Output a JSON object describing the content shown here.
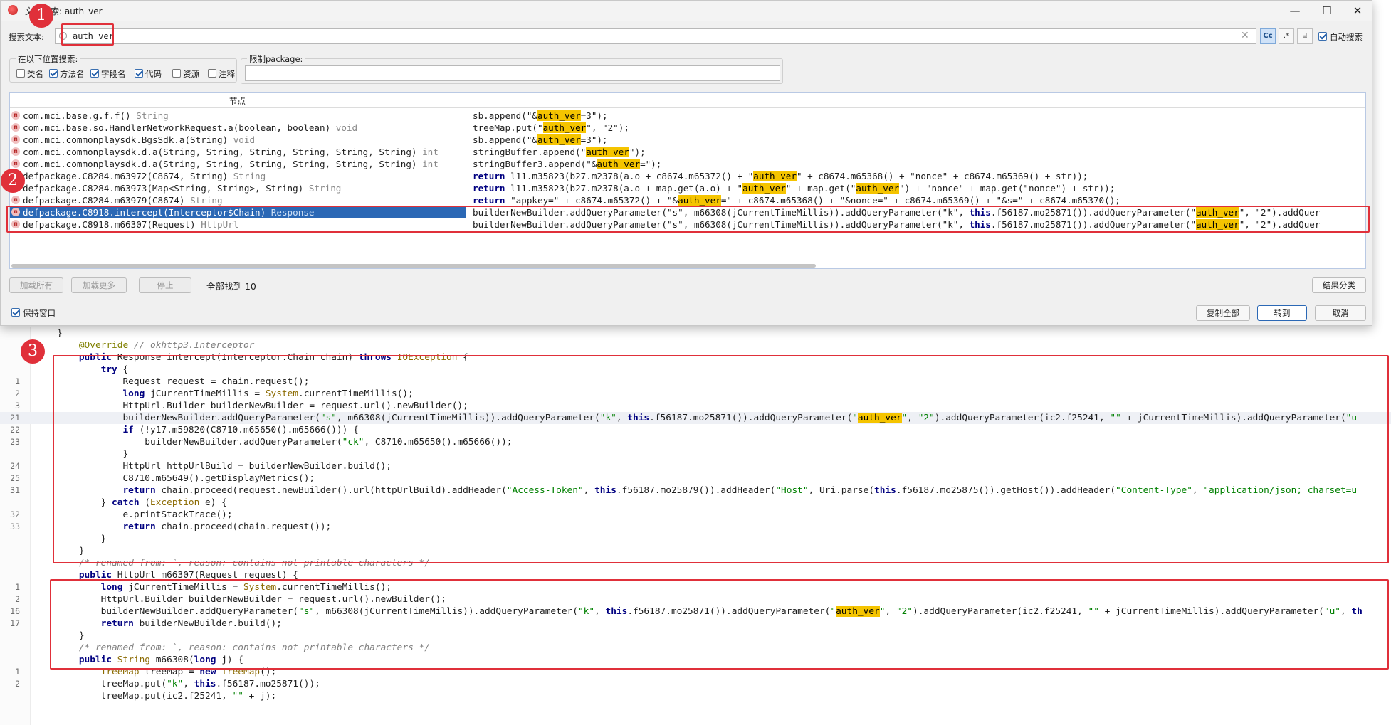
{
  "window": {
    "title": "文本搜索: auth_ver",
    "minimize": "—",
    "maximize": "☐",
    "close": "✕"
  },
  "search": {
    "label": "搜索文本:",
    "value": "auth_ver",
    "auto_search_label": "自动搜索",
    "auto_search_checked": true,
    "toolbar": {
      "case_sensitive": "Cc",
      "regex": ".*",
      "word": "⌸"
    }
  },
  "scope": {
    "title": "在以下位置搜索:",
    "options": [
      {
        "label": "类名",
        "checked": false
      },
      {
        "label": "方法名",
        "checked": true
      },
      {
        "label": "字段名",
        "checked": true
      },
      {
        "label": "代码",
        "checked": true
      },
      {
        "label": "资源",
        "checked": false
      },
      {
        "label": "注释",
        "checked": false
      }
    ]
  },
  "package_filter": {
    "title": "限制package:",
    "value": ""
  },
  "results": {
    "column_node": "节点",
    "rows": [
      {
        "node": "com.mci.base.g.f.f()",
        "type": "String",
        "code": [
          [
            "",
            "sb.append(\"&"
          ],
          [
            "hit",
            "auth_ver"
          ],
          [
            "",
            "=3\");"
          ]
        ]
      },
      {
        "node": "com.mci.base.so.HandlerNetworkRequest.a(boolean, boolean)",
        "type": "void",
        "code": [
          [
            "",
            "treeMap.put(\""
          ],
          [
            "hit",
            "auth_ver"
          ],
          [
            "",
            "\", \"2\");"
          ]
        ]
      },
      {
        "node": "com.mci.commonplaysdk.BgsSdk.a(String)",
        "type": "void",
        "code": [
          [
            "",
            "sb.append(\"&"
          ],
          [
            "hit",
            "auth_ver"
          ],
          [
            "",
            "=3\");"
          ]
        ]
      },
      {
        "node": "com.mci.commonplaysdk.d.a(String, String, String, String, String, String)",
        "type": "int",
        "code": [
          [
            "",
            "stringBuffer.append(\""
          ],
          [
            "hit",
            "auth_ver"
          ],
          [
            "",
            "\");"
          ]
        ]
      },
      {
        "node": "com.mci.commonplaysdk.d.a(String, String, String, String, String, String)",
        "type": "int",
        "code": [
          [
            "",
            "stringBuffer3.append(\"&"
          ],
          [
            "hit",
            "auth_ver"
          ],
          [
            "",
            "=\");"
          ]
        ]
      },
      {
        "node": "defpackage.C8284.m63972(C8674, String)",
        "type": "String",
        "code": [
          [
            "kw",
            "return"
          ],
          [
            "",
            " l11.m35823(b27.m2378(a.o + c8674.m65372() + \""
          ],
          [
            "hit",
            "auth_ver"
          ],
          [
            "",
            "\" + c8674.m65368() + \"nonce\" + c8674.m65369() + str));"
          ]
        ]
      },
      {
        "node": "defpackage.C8284.m63973(Map<String, String>, String)",
        "type": "String",
        "code": [
          [
            "kw",
            "return"
          ],
          [
            "",
            " l11.m35823(b27.m2378(a.o + map.get(a.o) + \""
          ],
          [
            "hit",
            "auth_ver"
          ],
          [
            "",
            "\" + map.get(\""
          ],
          [
            "hit",
            "auth_ver"
          ],
          [
            "",
            "\") + \"nonce\" + map.get(\"nonce\") + str));"
          ]
        ]
      },
      {
        "node": "defpackage.C8284.m63979(C8674)",
        "type": "String",
        "code": [
          [
            "kw",
            "return"
          ],
          [
            "",
            " \"appkey=\" + c8674.m65372() + \"&"
          ],
          [
            "hit",
            "auth_ver"
          ],
          [
            "",
            "=\" + c8674.m65368() + \"&nonce=\" + c8674.m65369() + \"&s=\" + c8674.m65370();"
          ]
        ]
      },
      {
        "node": "defpackage.C8918.intercept(Interceptor$Chain)",
        "type": "Response",
        "selected": true,
        "code": [
          [
            "",
            "builderNewBuilder.addQueryParameter(\"s\", m66308(jCurrentTimeMillis)).addQueryParameter(\"k\", "
          ],
          [
            "kw",
            "this"
          ],
          [
            "",
            ".f56187.mo25871()).addQueryParameter(\""
          ],
          [
            "hit",
            "auth_ver"
          ],
          [
            "",
            "\", \"2\").addQuer"
          ]
        ]
      },
      {
        "node": "defpackage.C8918.m66307(Request)",
        "type": "HttpUrl",
        "code": [
          [
            "",
            "builderNewBuilder.addQueryParameter(\"s\", m66308(jCurrentTimeMillis)).addQueryParameter(\"k\", "
          ],
          [
            "kw",
            "this"
          ],
          [
            "",
            ".f56187.mo25871()).addQueryParameter(\""
          ],
          [
            "hit",
            "auth_ver"
          ],
          [
            "",
            "\", \"2\").addQuer"
          ]
        ]
      }
    ]
  },
  "bottom": {
    "load_all": "加载所有",
    "load_more": "加载更多",
    "stop": "停止",
    "found": "全部找到 10",
    "group_results": "结果分类",
    "keep_window": "保持窗口",
    "keep_window_checked": true,
    "copy_all": "复制全部",
    "goto": "转到",
    "cancel": "取消"
  },
  "badges": [
    "1",
    "2",
    "3"
  ],
  "editor": {
    "lines": [
      {
        "n": "",
        "code": [
          [
            "",
            "}"
          ]
        ]
      },
      {
        "n": "",
        "code": [
          [
            "",
            "    "
          ],
          [
            "ann",
            "@Override"
          ],
          [
            "cm",
            " // okhttp3.Interceptor"
          ]
        ]
      },
      {
        "n": "",
        "code": [
          [
            "",
            "    "
          ],
          [
            "kw",
            "public"
          ],
          [
            "",
            " Response intercept(Interceptor.Chain chain) "
          ],
          [
            "kw",
            "throws"
          ],
          [
            "",
            " "
          ],
          [
            "ty",
            "IOException"
          ],
          [
            "",
            " {"
          ]
        ]
      },
      {
        "n": "",
        "code": [
          [
            "",
            "        "
          ],
          [
            "kw",
            "try"
          ],
          [
            "",
            " {"
          ]
        ]
      },
      {
        "n": "1",
        "code": [
          [
            "",
            "            Request request = chain.request();"
          ]
        ]
      },
      {
        "n": "2",
        "code": [
          [
            "",
            "            "
          ],
          [
            "kw",
            "long"
          ],
          [
            "",
            " jCurrentTimeMillis = "
          ],
          [
            "ty",
            "System"
          ],
          [
            "",
            ".currentTimeMillis();"
          ]
        ]
      },
      {
        "n": "3",
        "code": [
          [
            "",
            "            HttpUrl.Builder builderNewBuilder = request.url().newBuilder();"
          ]
        ]
      },
      {
        "n": "21",
        "hl": true,
        "code": [
          [
            "",
            "            builderNewBuilder.addQueryParameter("
          ],
          [
            "str",
            "\"s\""
          ],
          [
            "",
            ", m66308(jCurrentTimeMillis)).addQueryParameter("
          ],
          [
            "str",
            "\"k\""
          ],
          [
            "",
            ", "
          ],
          [
            "kw",
            "this"
          ],
          [
            "",
            ".f56187.mo25871()).addQueryParameter("
          ],
          [
            "str",
            "\""
          ],
          [
            "hit",
            "auth_ver"
          ],
          [
            "str",
            "\""
          ],
          [
            "",
            ", "
          ],
          [
            "str",
            "\"2\""
          ],
          [
            "",
            ").addQueryParameter(ic2.f25241, "
          ],
          [
            "str",
            "\"\""
          ],
          [
            "",
            " + jCurrentTimeMillis).addQueryParameter("
          ],
          [
            "str",
            "\"u"
          ]
        ]
      },
      {
        "n": "22",
        "code": [
          [
            "",
            "            "
          ],
          [
            "kw",
            "if"
          ],
          [
            "",
            " (!y17.m59820(C8710.m65650().m65666())) {"
          ]
        ]
      },
      {
        "n": "23",
        "code": [
          [
            "",
            "                builderNewBuilder.addQueryParameter("
          ],
          [
            "str",
            "\"ck\""
          ],
          [
            "",
            ", C8710.m65650().m65666());"
          ]
        ]
      },
      {
        "n": "",
        "code": [
          [
            "",
            "            }"
          ]
        ]
      },
      {
        "n": "24",
        "code": [
          [
            "",
            "            HttpUrl httpUrlBuild = builderNewBuilder.build();"
          ]
        ]
      },
      {
        "n": "25",
        "code": [
          [
            "",
            "            C8710.m65649().getDisplayMetrics();"
          ]
        ]
      },
      {
        "n": "31",
        "code": [
          [
            "",
            "            "
          ],
          [
            "kw",
            "return"
          ],
          [
            "",
            " chain.proceed(request.newBuilder().url(httpUrlBuild).addHeader("
          ],
          [
            "str",
            "\"Access-Token\""
          ],
          [
            "",
            ", "
          ],
          [
            "kw",
            "this"
          ],
          [
            "",
            ".f56187.mo25879()).addHeader("
          ],
          [
            "str",
            "\"Host\""
          ],
          [
            "",
            ", Uri.parse("
          ],
          [
            "kw",
            "this"
          ],
          [
            "",
            ".f56187.mo25875()).getHost()).addHeader("
          ],
          [
            "str",
            "\"Content-Type\""
          ],
          [
            "",
            ", "
          ],
          [
            "str",
            "\"application/json; charset=u"
          ]
        ]
      },
      {
        "n": "",
        "code": [
          [
            "",
            "        } "
          ],
          [
            "kw",
            "catch"
          ],
          [
            "",
            " ("
          ],
          [
            "ty",
            "Exception"
          ],
          [
            "",
            " e) {"
          ]
        ]
      },
      {
        "n": "32",
        "code": [
          [
            "",
            "            e.printStackTrace();"
          ]
        ]
      },
      {
        "n": "33",
        "code": [
          [
            "",
            "            "
          ],
          [
            "kw",
            "return"
          ],
          [
            "",
            " chain.proceed(chain.request());"
          ]
        ]
      },
      {
        "n": "",
        "code": [
          [
            "",
            "        }"
          ]
        ]
      },
      {
        "n": "",
        "code": [
          [
            "",
            "    }"
          ]
        ]
      },
      {
        "n": "",
        "code": [
          [
            "",
            "    "
          ],
          [
            "cm",
            "/* renamed from: `, reason: contains not printable characters */"
          ]
        ]
      },
      {
        "n": "",
        "code": [
          [
            "",
            "    "
          ],
          [
            "kw",
            "public"
          ],
          [
            "",
            " HttpUrl m66307(Request request) {"
          ]
        ]
      },
      {
        "n": "1",
        "code": [
          [
            "",
            "        "
          ],
          [
            "kw",
            "long"
          ],
          [
            "",
            " jCurrentTimeMillis = "
          ],
          [
            "ty",
            "System"
          ],
          [
            "",
            ".currentTimeMillis();"
          ]
        ]
      },
      {
        "n": "2",
        "code": [
          [
            "",
            "        HttpUrl.Builder builderNewBuilder = request.url().newBuilder();"
          ]
        ]
      },
      {
        "n": "16",
        "code": [
          [
            "",
            "        builderNewBuilder.addQueryParameter("
          ],
          [
            "str",
            "\"s\""
          ],
          [
            "",
            ", m66308(jCurrentTimeMillis)).addQueryParameter("
          ],
          [
            "str",
            "\"k\""
          ],
          [
            "",
            ", "
          ],
          [
            "kw",
            "this"
          ],
          [
            "",
            ".f56187.mo25871()).addQueryParameter("
          ],
          [
            "str",
            "\""
          ],
          [
            "hit",
            "auth_ver"
          ],
          [
            "str",
            "\""
          ],
          [
            "",
            ", "
          ],
          [
            "str",
            "\"2\""
          ],
          [
            "",
            ").addQueryParameter(ic2.f25241, "
          ],
          [
            "str",
            "\"\""
          ],
          [
            "",
            " + jCurrentTimeMillis).addQueryParameter("
          ],
          [
            "str",
            "\"u\""
          ],
          [
            "",
            ", "
          ],
          [
            "kw",
            "th"
          ]
        ]
      },
      {
        "n": "17",
        "code": [
          [
            "",
            "        "
          ],
          [
            "kw",
            "return"
          ],
          [
            "",
            " builderNewBuilder.build();"
          ]
        ]
      },
      {
        "n": "",
        "code": [
          [
            "",
            "    }"
          ]
        ]
      },
      {
        "n": "",
        "code": [
          [
            "",
            "    "
          ],
          [
            "cm",
            "/* renamed from: `, reason: contains not printable characters */"
          ]
        ]
      },
      {
        "n": "",
        "code": [
          [
            "",
            "    "
          ],
          [
            "kw",
            "public"
          ],
          [
            "",
            " "
          ],
          [
            "ty",
            "String"
          ],
          [
            "",
            " m66308("
          ],
          [
            "kw",
            "long"
          ],
          [
            "",
            " j) {"
          ]
        ]
      },
      {
        "n": "1",
        "code": [
          [
            "",
            "        "
          ],
          [
            "ty",
            "TreeMap"
          ],
          [
            "",
            " treeMap = "
          ],
          [
            "kw",
            "new"
          ],
          [
            "",
            " "
          ],
          [
            "ty",
            "TreeMap"
          ],
          [
            "",
            "();"
          ]
        ]
      },
      {
        "n": "2",
        "code": [
          [
            "",
            "        treeMap.put("
          ],
          [
            "str",
            "\"k\""
          ],
          [
            "",
            ", "
          ],
          [
            "kw",
            "this"
          ],
          [
            "",
            ".f56187.mo25871());"
          ]
        ]
      },
      {
        "n": "",
        "code": [
          [
            "",
            "        treeMap.put(ic2.f25241, "
          ],
          [
            "str",
            "\"\""
          ],
          [
            "",
            " + j);"
          ]
        ]
      }
    ]
  },
  "colors": {
    "highlight": "#f5c400",
    "selection": "#2b68b5",
    "annotation_red": "#e0303a"
  }
}
